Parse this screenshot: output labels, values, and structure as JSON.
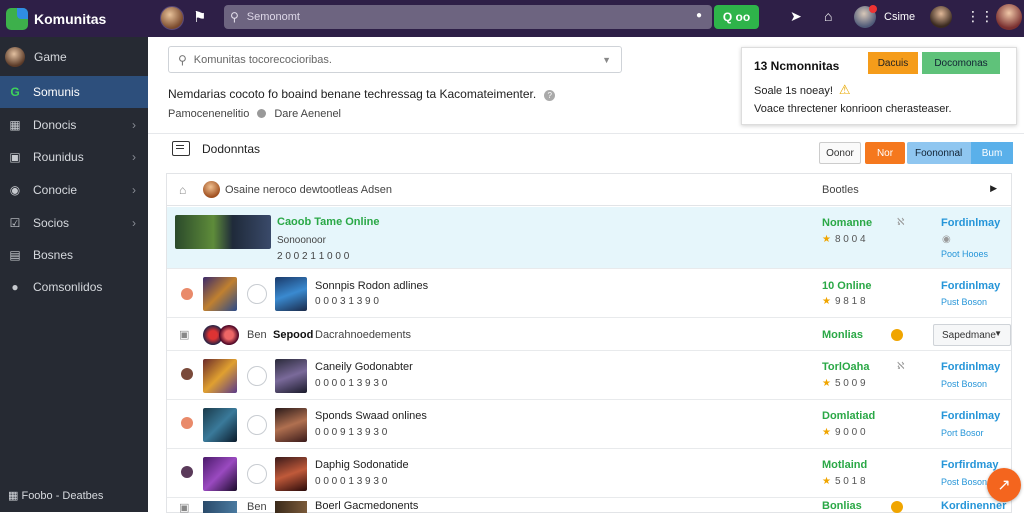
{
  "app": {
    "name": "Komunitas"
  },
  "topbar": {
    "search_text": "Semonomt",
    "search_button": "Q oo",
    "user_name": "Csime",
    "icons": [
      "bell-icon",
      "rocket-icon",
      "trophy-icon",
      "grid-icon"
    ]
  },
  "sidebar": {
    "user": "Game",
    "items": [
      {
        "label": "Somunis",
        "icon": "g-icon",
        "active": true
      },
      {
        "label": "Donocis",
        "icon": "chart-icon"
      },
      {
        "label": "Rounidus",
        "icon": "tv-icon"
      },
      {
        "label": "Conocie",
        "icon": "target-icon"
      },
      {
        "label": "Socios",
        "icon": "check-icon"
      },
      {
        "label": "Bosnes",
        "icon": "doc-icon"
      },
      {
        "label": "Comsonlidos",
        "icon": "circle-icon"
      }
    ],
    "footer": "Foobo  -  Deatbes"
  },
  "main": {
    "search_placeholder": "Komunitas tocorecocioribas.",
    "info_text": "Nemdarias cocoto fo boaind benane techressag ta Kacomateimenter.",
    "sub_left": "Pamocenenelitio",
    "sub_right": "Dare Aenenel"
  },
  "notification": {
    "title": "13 Ncmonnitas",
    "btn1": "Dacuis",
    "btn2": "Docomonas",
    "line2": "Soale 1s noeay!",
    "line3": "Voace threctener konrioon cherasteaser."
  },
  "section": {
    "title": "Dodonntas",
    "btn_other": "Oonor",
    "btn_orange": "Nor",
    "btn_blue": "Foononnal",
    "btn_blue2": "Bum"
  },
  "list_head": {
    "text": "Osaine neroco dewtootleas Adsen",
    "status": "Bootles"
  },
  "rows": [
    {
      "title": "Caoob Tame Online",
      "sub": "Sonoonoor",
      "meta": "2 0 0 2 1 1 0 0 0",
      "status": "Nomanne",
      "stars": "8 0 0 4",
      "link": "Fordinlmay",
      "link2": "Poot Hooes",
      "mid": "ℵ"
    },
    {
      "title": "Sonnpis Rodon adlines",
      "sub": "0 0 0 3 1 3 9 0",
      "status": "10 Online",
      "stars": "9 8 1 8",
      "link": "Fordinlmay",
      "link2": "Pust Boson"
    },
    {
      "prefix": "Ben",
      "title": "Sepood",
      "sub": "Dacrahnoedements",
      "status": "Monlias",
      "dropdown": "Sapedmane"
    },
    {
      "title": "Caneily Godonabter",
      "sub": "0 0 0 0 1 3 9 3 0",
      "status": "TorlOaha",
      "stars": "5 0 0 9",
      "link": "Fordinlmay",
      "link2": "Post Boson",
      "mid": "ℵ"
    },
    {
      "title": "Sponds Swaad onlines",
      "sub": "0 0 0 9 1 3 9 3 0",
      "status": "Domlatiad",
      "stars": "9 0 0 0",
      "link": "Fordinlmay",
      "link2": "Port Bosor"
    },
    {
      "title": "Daphig Sodonatide",
      "sub": "0 0 0 0 1 3 9 3 0",
      "status": "Motlaind",
      "stars": "5 0 1 8",
      "link": "Forfirdmay",
      "link2": "Post Boson"
    },
    {
      "prefix": "Ben",
      "title": "Boerl Gacmedonents",
      "status": "Bonlias",
      "link": "Kordinenner"
    }
  ]
}
